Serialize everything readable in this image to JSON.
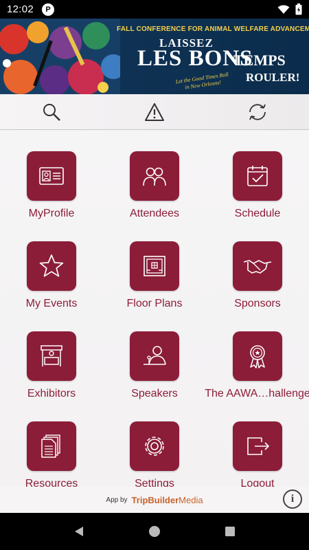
{
  "status": {
    "time": "12:02",
    "app_badge": "P"
  },
  "banner": {
    "subtitle": "FALL CONFERENCE FOR ANIMAL WELFARE ADVANCEMENT",
    "line1": "LAISSEZ",
    "line2": "LES BONS",
    "line3": "TEMPS",
    "line4": "ROULER!",
    "tagline": "Let the Good Times Roll in New Orleans!"
  },
  "toolbar": {
    "search_icon": "search-icon",
    "alert_icon": "warning-icon",
    "sync_icon": "sync-icon"
  },
  "tiles": [
    {
      "label": "MyProfile",
      "icon": "id-card-icon"
    },
    {
      "label": "Attendees",
      "icon": "people-icon"
    },
    {
      "label": "Schedule",
      "icon": "calendar-check-icon"
    },
    {
      "label": "My Events",
      "icon": "star-icon"
    },
    {
      "label": "Floor Plans",
      "icon": "floor-plan-icon"
    },
    {
      "label": "Sponsors",
      "icon": "handshake-icon"
    },
    {
      "label": "Exhibitors",
      "icon": "booth-icon"
    },
    {
      "label": "Speakers",
      "icon": "speaker-icon"
    },
    {
      "label": "The AAWA…hallenge",
      "icon": "ribbon-icon"
    },
    {
      "label": "Resources",
      "icon": "documents-icon"
    },
    {
      "label": "Settings",
      "icon": "gear-icon"
    },
    {
      "label": "Logout",
      "icon": "logout-icon"
    }
  ],
  "footer": {
    "prefix": "App by",
    "brand_bold": "TripBuilder",
    "brand_rest": "Media",
    "info": "i"
  },
  "colors": {
    "accent": "#8b1d38",
    "brand": "#c8622a"
  }
}
